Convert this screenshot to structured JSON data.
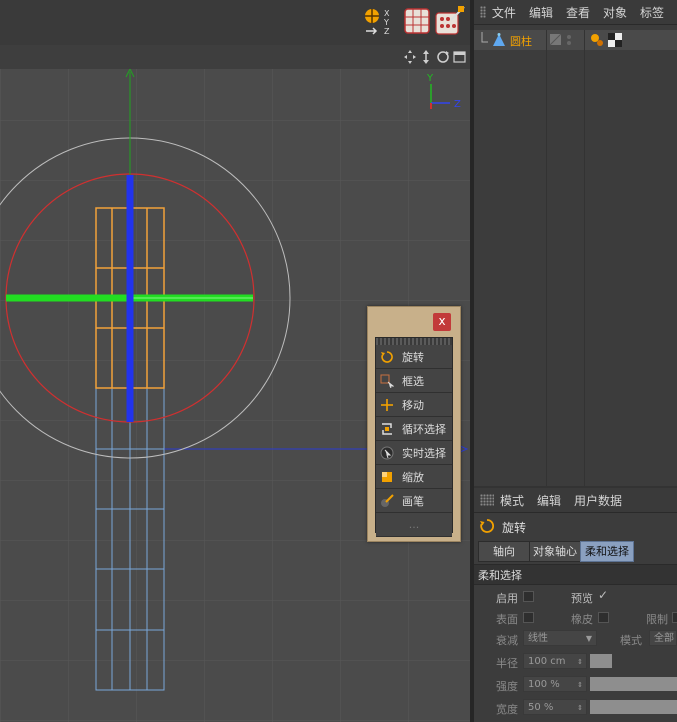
{
  "object_manager": {
    "menu": [
      "文件",
      "编辑",
      "查看",
      "对象",
      "标签"
    ],
    "object_name": "圆柱"
  },
  "axis_labels": {
    "y": "Y",
    "z": "Z"
  },
  "tool_palette": {
    "close_label": "x",
    "items": [
      {
        "label": "旋转",
        "icon": "rotate-icon"
      },
      {
        "label": "框选",
        "icon": "rectangle-select-icon"
      },
      {
        "label": "移动",
        "icon": "move-icon"
      },
      {
        "label": "循环选择",
        "icon": "loop-select-icon"
      },
      {
        "label": "实时选择",
        "icon": "live-select-icon"
      },
      {
        "label": "缩放",
        "icon": "scale-icon"
      },
      {
        "label": "画笔",
        "icon": "brush-icon"
      }
    ],
    "more": "..."
  },
  "attribute_manager": {
    "menu": [
      "模式",
      "编辑",
      "用户数据"
    ],
    "tool_title": "旋转",
    "tabs": [
      "轴向",
      "对象轴心",
      "柔和选择"
    ],
    "active_tab": "柔和选择",
    "section_title": "柔和选择",
    "enable_label": "启用",
    "preview_label": "预览",
    "preview_check": "✓",
    "surface_label": "表面",
    "rubber_label": "橡皮",
    "limit_label": "限制",
    "falloff_label": "衰减",
    "falloff_value": "线性",
    "mode_label": "模式",
    "mode_value": "全部",
    "radius_label": "半径",
    "radius_value": "100 cm",
    "strength_label": "强度",
    "strength_value": "100 %",
    "width_label": "宽度",
    "width_value": "50 %"
  },
  "colors": {
    "accent_orange": "#f2a100",
    "axis_green": "#22dd22",
    "axis_blue": "#2233ee",
    "selection_orange": "#f2a13a",
    "ring_red": "#d03030",
    "active_tab": "#8aa0c0"
  }
}
